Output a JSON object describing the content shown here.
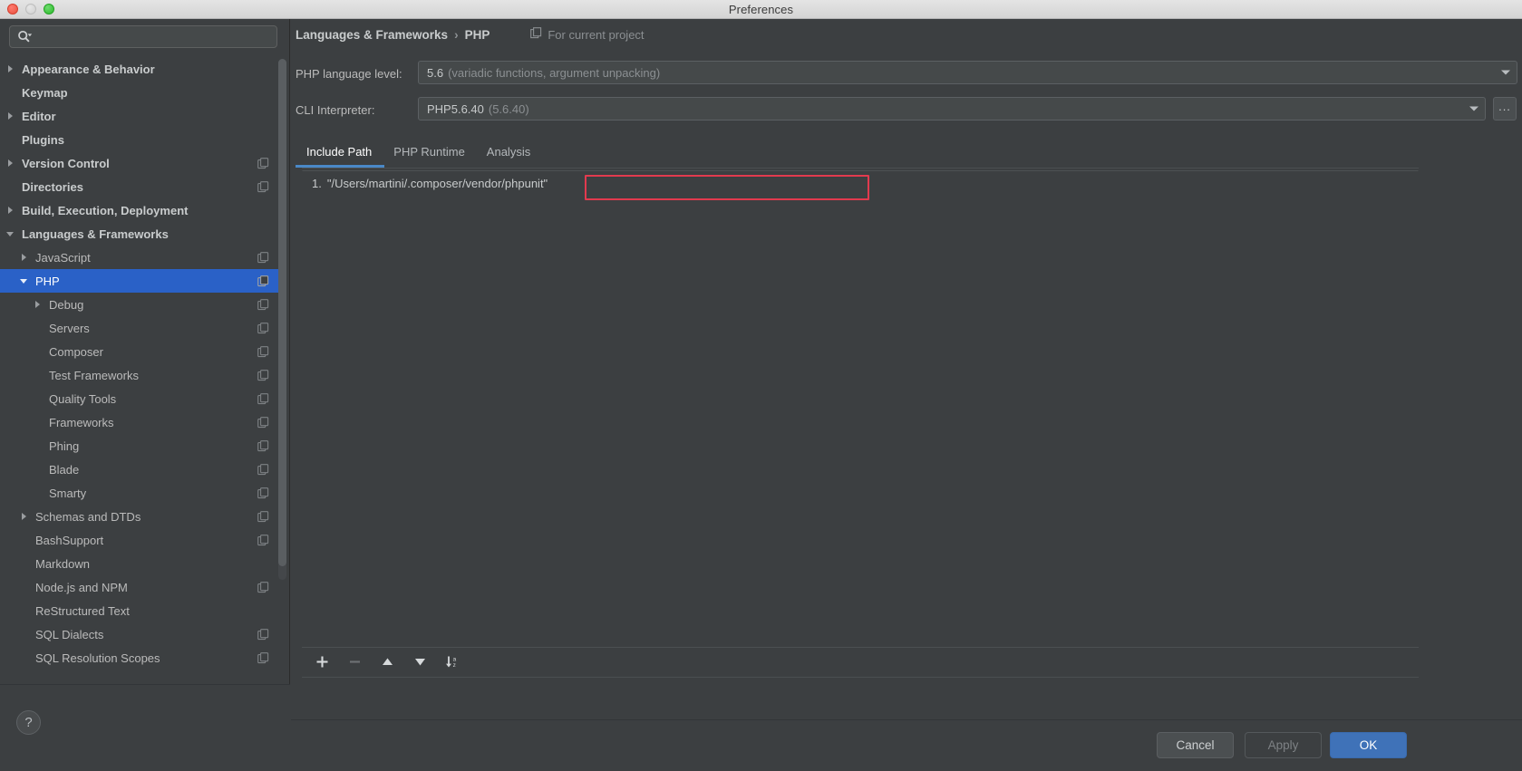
{
  "window": {
    "title": "Preferences",
    "traffic_lights": [
      "close-button",
      "minimize-button",
      "maximize-button"
    ]
  },
  "sidebar": {
    "search": {
      "value": "",
      "placeholder": "",
      "icon": "search-icon"
    },
    "items": [
      {
        "label": "Appearance & Behavior",
        "indent": 0,
        "twisty": "collapsed",
        "bold": true,
        "project_icon": false,
        "selected": false
      },
      {
        "label": "Keymap",
        "indent": 0,
        "twisty": "none",
        "bold": true,
        "project_icon": false,
        "selected": false
      },
      {
        "label": "Editor",
        "indent": 0,
        "twisty": "collapsed",
        "bold": true,
        "project_icon": false,
        "selected": false
      },
      {
        "label": "Plugins",
        "indent": 0,
        "twisty": "none",
        "bold": true,
        "project_icon": false,
        "selected": false
      },
      {
        "label": "Version Control",
        "indent": 0,
        "twisty": "collapsed",
        "bold": true,
        "project_icon": true,
        "selected": false
      },
      {
        "label": "Directories",
        "indent": 0,
        "twisty": "none",
        "bold": true,
        "project_icon": true,
        "selected": false
      },
      {
        "label": "Build, Execution, Deployment",
        "indent": 0,
        "twisty": "collapsed",
        "bold": true,
        "project_icon": false,
        "selected": false
      },
      {
        "label": "Languages & Frameworks",
        "indent": 0,
        "twisty": "expanded",
        "bold": true,
        "project_icon": false,
        "selected": false
      },
      {
        "label": "JavaScript",
        "indent": 1,
        "twisty": "collapsed",
        "bold": false,
        "project_icon": true,
        "selected": false
      },
      {
        "label": "PHP",
        "indent": 1,
        "twisty": "expanded",
        "bold": false,
        "project_icon": true,
        "selected": true
      },
      {
        "label": "Debug",
        "indent": 2,
        "twisty": "collapsed",
        "bold": false,
        "project_icon": true,
        "selected": false
      },
      {
        "label": "Servers",
        "indent": 2,
        "twisty": "none",
        "bold": false,
        "project_icon": true,
        "selected": false
      },
      {
        "label": "Composer",
        "indent": 2,
        "twisty": "none",
        "bold": false,
        "project_icon": true,
        "selected": false
      },
      {
        "label": "Test Frameworks",
        "indent": 2,
        "twisty": "none",
        "bold": false,
        "project_icon": true,
        "selected": false
      },
      {
        "label": "Quality Tools",
        "indent": 2,
        "twisty": "none",
        "bold": false,
        "project_icon": true,
        "selected": false
      },
      {
        "label": "Frameworks",
        "indent": 2,
        "twisty": "none",
        "bold": false,
        "project_icon": true,
        "selected": false
      },
      {
        "label": "Phing",
        "indent": 2,
        "twisty": "none",
        "bold": false,
        "project_icon": true,
        "selected": false
      },
      {
        "label": "Blade",
        "indent": 2,
        "twisty": "none",
        "bold": false,
        "project_icon": true,
        "selected": false
      },
      {
        "label": "Smarty",
        "indent": 2,
        "twisty": "none",
        "bold": false,
        "project_icon": true,
        "selected": false
      },
      {
        "label": "Schemas and DTDs",
        "indent": 1,
        "twisty": "collapsed",
        "bold": false,
        "project_icon": true,
        "selected": false
      },
      {
        "label": "BashSupport",
        "indent": 1,
        "twisty": "none",
        "bold": false,
        "project_icon": true,
        "selected": false
      },
      {
        "label": "Markdown",
        "indent": 1,
        "twisty": "none",
        "bold": false,
        "project_icon": false,
        "selected": false
      },
      {
        "label": "Node.js and NPM",
        "indent": 1,
        "twisty": "none",
        "bold": false,
        "project_icon": true,
        "selected": false
      },
      {
        "label": "ReStructured Text",
        "indent": 1,
        "twisty": "none",
        "bold": false,
        "project_icon": false,
        "selected": false
      },
      {
        "label": "SQL Dialects",
        "indent": 1,
        "twisty": "none",
        "bold": false,
        "project_icon": true,
        "selected": false
      },
      {
        "label": "SQL Resolution Scopes",
        "indent": 1,
        "twisty": "none",
        "bold": false,
        "project_icon": true,
        "selected": false
      }
    ],
    "help_button": "?"
  },
  "header": {
    "breadcrumb_root": "Languages & Frameworks",
    "breadcrumb_sep": "›",
    "breadcrumb_leaf": "PHP",
    "scope_label": "For current project",
    "scope_icon": "project-scope-icon"
  },
  "fields": {
    "language_level": {
      "label": "PHP language level:",
      "value": "5.6",
      "value_hint": "(variadic functions, argument unpacking)"
    },
    "cli_interpreter": {
      "label": "CLI Interpreter:",
      "value": "PHP5.6.40",
      "value_hint": "(5.6.40)",
      "browse_button": "..."
    }
  },
  "tabs": {
    "items": [
      {
        "label": "Include Path",
        "active": true
      },
      {
        "label": "PHP Runtime",
        "active": false
      },
      {
        "label": "Analysis",
        "active": false
      }
    ]
  },
  "include_path": {
    "rows": [
      {
        "index": "1.",
        "path": "\"/Users/martini/.composer/vendor/phpunit\"",
        "highlighted": true
      }
    ],
    "toolbar": [
      {
        "name": "add-button",
        "glyph": "+",
        "enabled": true
      },
      {
        "name": "remove-button",
        "glyph": "−",
        "enabled": false
      },
      {
        "name": "move-up-button",
        "glyph": "▲",
        "enabled": true
      },
      {
        "name": "move-down-button",
        "glyph": "▼",
        "enabled": true
      },
      {
        "name": "sort-button",
        "glyph": "sort-az-icon",
        "enabled": true
      }
    ]
  },
  "footer": {
    "cancel": "Cancel",
    "apply": "Apply",
    "ok": "OK"
  },
  "colors": {
    "bg": "#3c3f41",
    "selection": "#2a61c7",
    "accent": "#4a88c7",
    "primary_button": "#3f72b8",
    "focus_highlight": "#e23a4e"
  }
}
